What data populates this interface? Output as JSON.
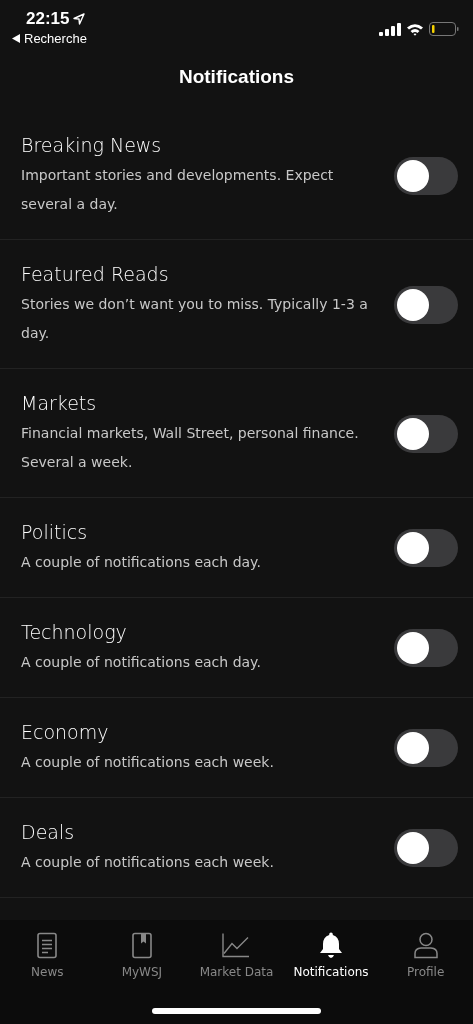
{
  "status_bar": {
    "time": "22:15",
    "back_label": "Recherche"
  },
  "header": {
    "title": "Notifications"
  },
  "settings": [
    {
      "title": "Breaking News",
      "description": "Important stories and developments. Expect several a day.",
      "on": false
    },
    {
      "title": "Featured Reads",
      "description": "Stories we don’t want you to miss. Typically 1-3 a day.",
      "on": false
    },
    {
      "title": "Markets",
      "description": "Financial markets, Wall Street, personal finance. Several a week.",
      "on": false
    },
    {
      "title": "Politics",
      "description": "A couple of notifications each day.",
      "on": false
    },
    {
      "title": "Technology",
      "description": "A couple of notifications each day.",
      "on": false
    },
    {
      "title": "Economy",
      "description": "A couple of notifications each week.",
      "on": false
    },
    {
      "title": "Deals",
      "description": "A couple of notifications each week.",
      "on": false
    }
  ],
  "tab_bar": [
    {
      "label": "News",
      "kind": "news",
      "selected": false
    },
    {
      "label": "MyWSJ",
      "kind": "bookmark",
      "selected": false
    },
    {
      "label": "Market Data",
      "kind": "chart",
      "selected": false
    },
    {
      "label": "Notifications",
      "kind": "bell",
      "selected": true
    },
    {
      "label": "Profile",
      "kind": "person",
      "selected": false
    }
  ]
}
